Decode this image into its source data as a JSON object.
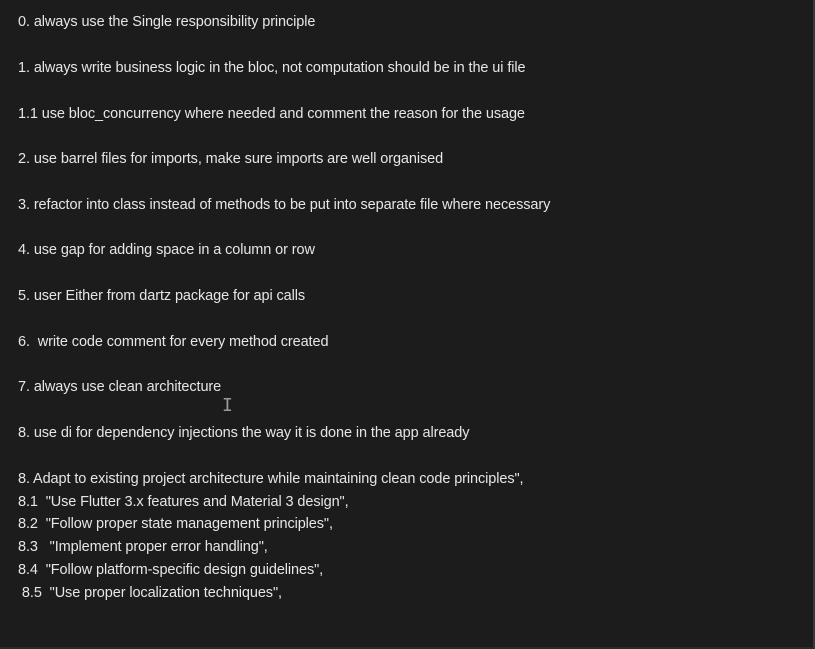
{
  "lines": [
    "0. always use the Single responsibility principle",
    "1. always write business logic in the bloc, not computation should be in the ui file",
    "1.1 use bloc_concurrency where needed and comment the reason for the usage",
    "2. use barrel files for imports, make sure imports are well organised",
    "3. refactor into class instead of methods to be put into separate file where necessary",
    "4. use gap for adding space in a column or row",
    "5. user Either from dartz package for api calls",
    "6.  write code comment for every method created",
    "7. always use clean architecture",
    "8. use di for dependency injections the way it is done in the app already",
    "8. Adapt to existing project architecture while maintaining clean code principles\",",
    "8.1  \"Use Flutter 3.x features and Material 3 design\",",
    "8.2  \"Follow proper state management principles\",",
    "8.3   \"Implement proper error handling\",",
    "8.4  \"Follow platform-specific design guidelines\",",
    " 8.5  \"Use proper localization techniques\","
  ],
  "cursor_glyph": "I"
}
